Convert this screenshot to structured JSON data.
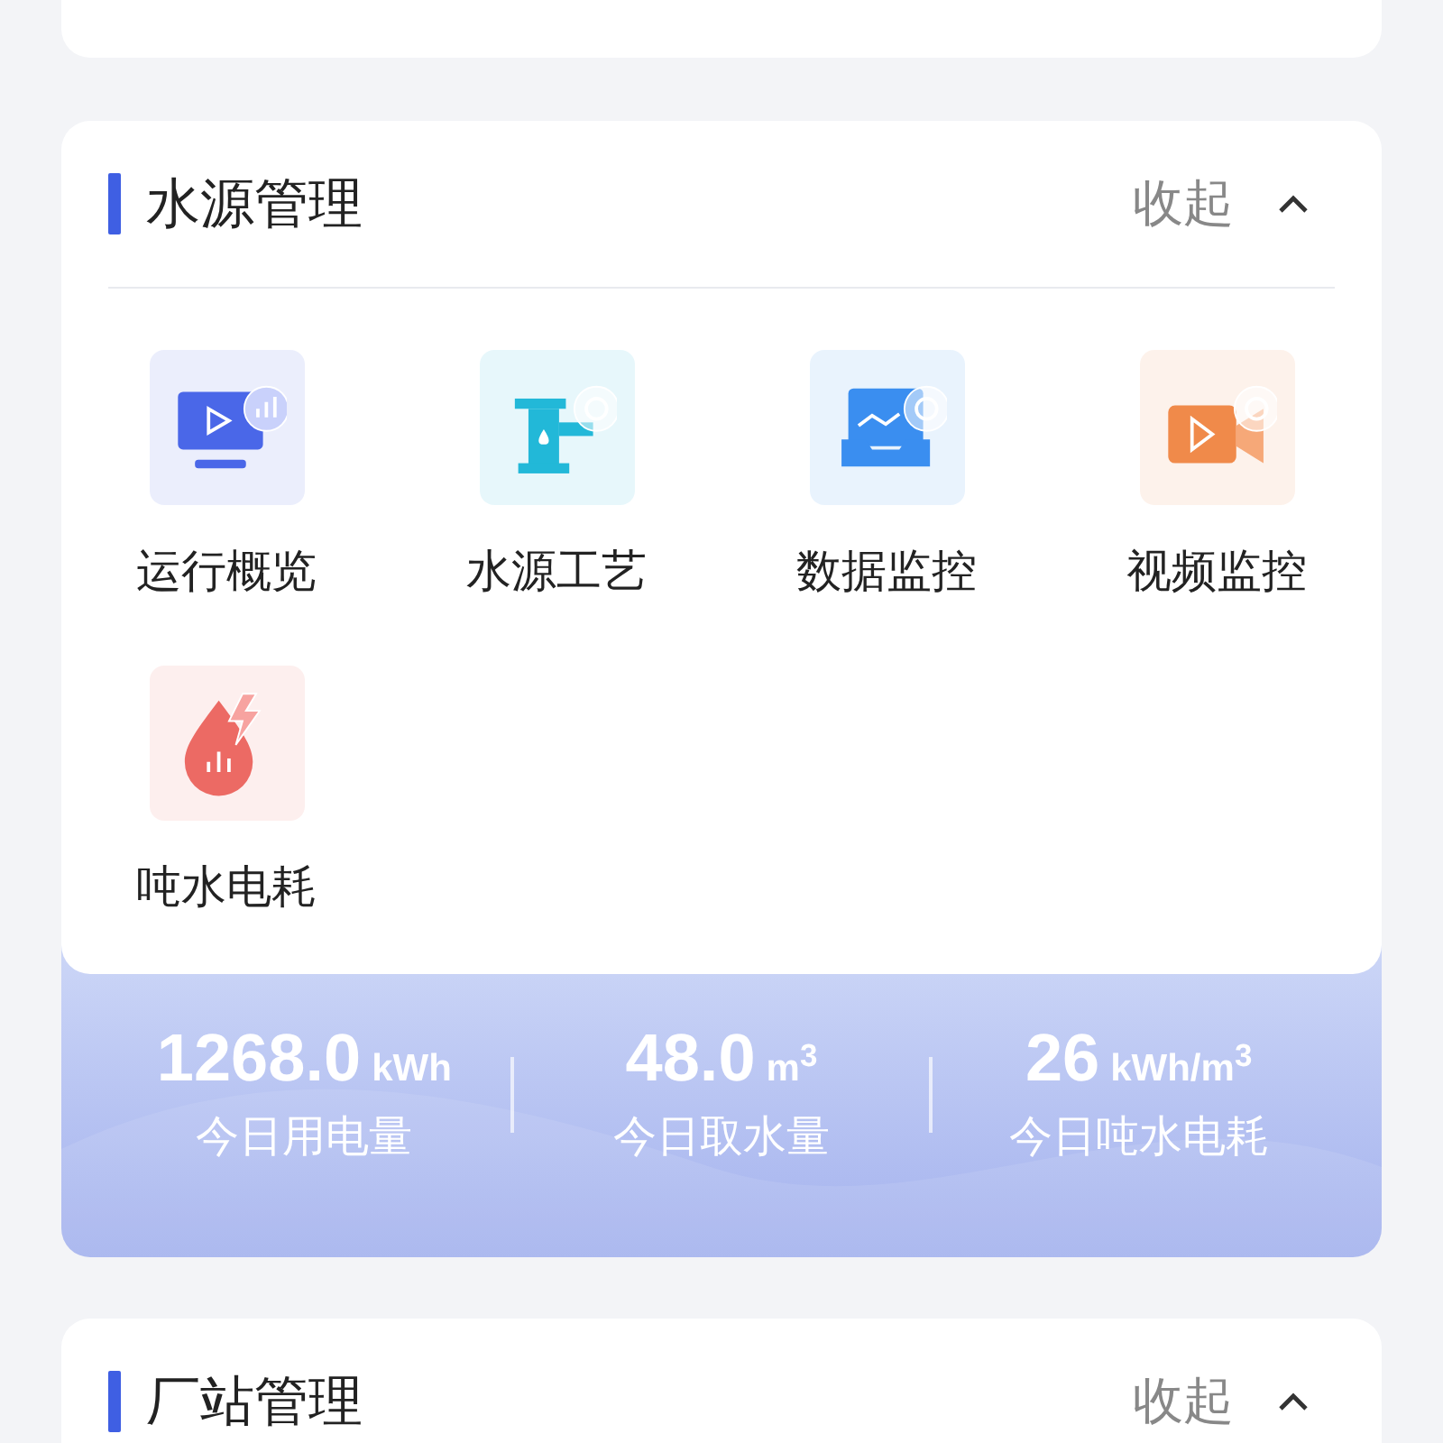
{
  "sections": [
    {
      "title": "水源管理",
      "toggle": "收起",
      "expanded": true,
      "items": [
        {
          "label": "运行概览",
          "kind": "monitor",
          "color": "#4a67e8"
        },
        {
          "label": "水源工艺",
          "kind": "pump",
          "color": "#22b8d8"
        },
        {
          "label": "数据监控",
          "kind": "tray",
          "color": "#3a8ef0"
        },
        {
          "label": "视频监控",
          "kind": "camera",
          "color": "#f08a4a"
        },
        {
          "label": "吨水电耗",
          "kind": "drop",
          "color": "#ec6a64"
        }
      ],
      "stats": [
        {
          "value": "1268.0",
          "unit": "kWh",
          "label": "今日用电量"
        },
        {
          "value": "48.0",
          "unit": "m$^{3}$",
          "label": "今日取水量"
        },
        {
          "value": "26",
          "unit": "kWh/m$^{3}$",
          "label": "今日吨水电耗"
        }
      ]
    },
    {
      "title": "厂站管理",
      "toggle": "收起",
      "expanded": true
    }
  ]
}
